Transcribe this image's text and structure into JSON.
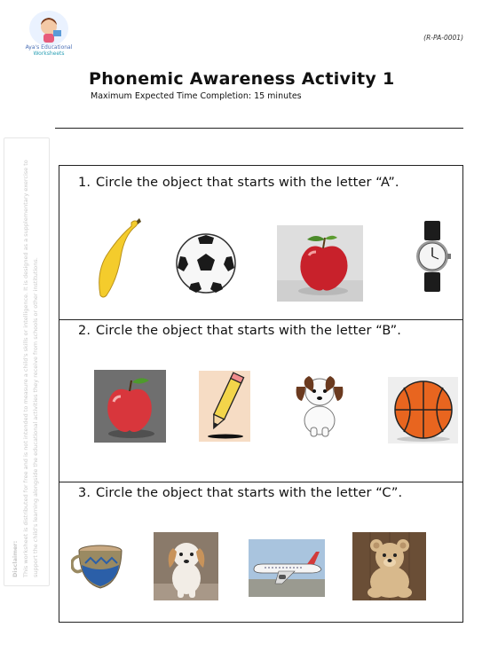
{
  "header": {
    "logo_text_line1": "Aya's Educational",
    "logo_text_line2": "Worksheets",
    "code": "(R-PA-0001)",
    "title": "Phonemic Awareness Activity 1",
    "subtitle": "Maximum Expected Time Completion: 15 minutes"
  },
  "disclaimer": {
    "heading": "Disclaimer:",
    "line1": "This worksheet is distributed for free and is not intended to measure a child's skills or intelligence. It is designed as a supplementary exercise to",
    "line2": "support the child's learning alongside the educational activities they receive from schools or other institutions."
  },
  "questions": [
    {
      "number": "1.",
      "text": "Circle the object that starts with the letter “A”.",
      "objects": [
        "banana",
        "soccer ball",
        "apple",
        "wristwatch"
      ]
    },
    {
      "number": "2.",
      "text": "Circle the object that starts with the letter “B”.",
      "objects": [
        "apple",
        "pencil",
        "puppy",
        "basketball"
      ]
    },
    {
      "number": "3.",
      "text": "Circle the object that starts with the letter “C”.",
      "objects": [
        "cup",
        "puppy",
        "airplane",
        "teddy bear"
      ]
    }
  ],
  "colors": {
    "border": "#222222",
    "logo_blue": "#4a6fb5"
  }
}
